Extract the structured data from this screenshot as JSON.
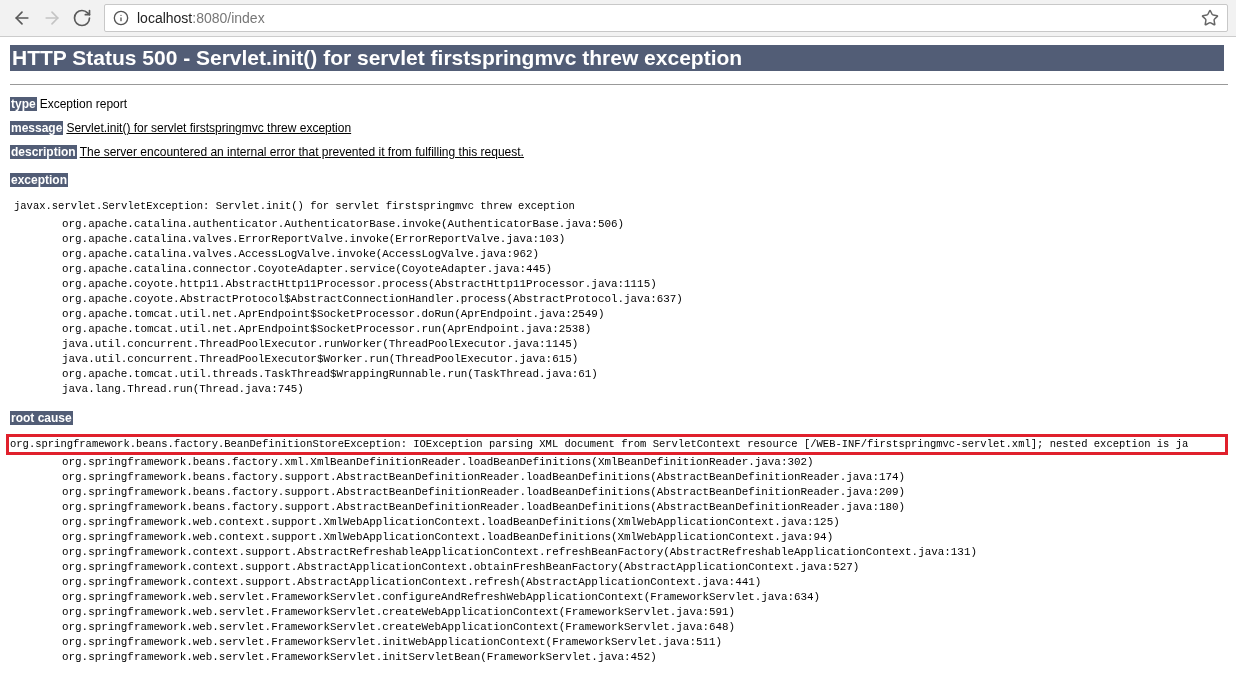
{
  "browser": {
    "nav": [
      {
        "kind": "back",
        "disabled": false
      },
      {
        "kind": "forward",
        "disabled": true
      },
      {
        "kind": "reload",
        "disabled": false
      }
    ],
    "url": {
      "host": "localhost",
      "path": ":8080/index"
    }
  },
  "page": {
    "title": "HTTP Status 500 - Servlet.init() for servlet firstspringmvc threw exception",
    "fields": [
      {
        "label": "type",
        "value": "Exception report",
        "kind": "plain"
      },
      {
        "label": "message",
        "value": "Servlet.init() for servlet firstspringmvc threw exception",
        "kind": "underlined"
      },
      {
        "label": "description",
        "value": "The server encountered an internal error that prevented it from fulfilling this request.",
        "kind": "underlined"
      }
    ],
    "traces": [
      {
        "label": "exception",
        "highlighted": false,
        "head": "javax.servlet.ServletException: Servlet.init() for servlet firstspringmvc threw exception",
        "frames": [
          "org.apache.catalina.authenticator.AuthenticatorBase.invoke(AuthenticatorBase.java:506)",
          "org.apache.catalina.valves.ErrorReportValve.invoke(ErrorReportValve.java:103)",
          "org.apache.catalina.valves.AccessLogValve.invoke(AccessLogValve.java:962)",
          "org.apache.catalina.connector.CoyoteAdapter.service(CoyoteAdapter.java:445)",
          "org.apache.coyote.http11.AbstractHttp11Processor.process(AbstractHttp11Processor.java:1115)",
          "org.apache.coyote.AbstractProtocol$AbstractConnectionHandler.process(AbstractProtocol.java:637)",
          "org.apache.tomcat.util.net.AprEndpoint$SocketProcessor.doRun(AprEndpoint.java:2549)",
          "org.apache.tomcat.util.net.AprEndpoint$SocketProcessor.run(AprEndpoint.java:2538)",
          "java.util.concurrent.ThreadPoolExecutor.runWorker(ThreadPoolExecutor.java:1145)",
          "java.util.concurrent.ThreadPoolExecutor$Worker.run(ThreadPoolExecutor.java:615)",
          "org.apache.tomcat.util.threads.TaskThread$WrappingRunnable.run(TaskThread.java:61)",
          "java.lang.Thread.run(Thread.java:745)"
        ]
      },
      {
        "label": "root cause",
        "highlighted": true,
        "head": "org.springframework.beans.factory.BeanDefinitionStoreException: IOException parsing XML document from ServletContext resource [/WEB-INF/firstspringmvc-servlet.xml]; nested exception is ja",
        "frames": [
          "org.springframework.beans.factory.xml.XmlBeanDefinitionReader.loadBeanDefinitions(XmlBeanDefinitionReader.java:302)",
          "org.springframework.beans.factory.support.AbstractBeanDefinitionReader.loadBeanDefinitions(AbstractBeanDefinitionReader.java:174)",
          "org.springframework.beans.factory.support.AbstractBeanDefinitionReader.loadBeanDefinitions(AbstractBeanDefinitionReader.java:209)",
          "org.springframework.beans.factory.support.AbstractBeanDefinitionReader.loadBeanDefinitions(AbstractBeanDefinitionReader.java:180)",
          "org.springframework.web.context.support.XmlWebApplicationContext.loadBeanDefinitions(XmlWebApplicationContext.java:125)",
          "org.springframework.web.context.support.XmlWebApplicationContext.loadBeanDefinitions(XmlWebApplicationContext.java:94)",
          "org.springframework.context.support.AbstractRefreshableApplicationContext.refreshBeanFactory(AbstractRefreshableApplicationContext.java:131)",
          "org.springframework.context.support.AbstractApplicationContext.obtainFreshBeanFactory(AbstractApplicationContext.java:527)",
          "org.springframework.context.support.AbstractApplicationContext.refresh(AbstractApplicationContext.java:441)",
          "org.springframework.web.servlet.FrameworkServlet.configureAndRefreshWebApplicationContext(FrameworkServlet.java:634)",
          "org.springframework.web.servlet.FrameworkServlet.createWebApplicationContext(FrameworkServlet.java:591)",
          "org.springframework.web.servlet.FrameworkServlet.createWebApplicationContext(FrameworkServlet.java:648)",
          "org.springframework.web.servlet.FrameworkServlet.initWebApplicationContext(FrameworkServlet.java:511)",
          "org.springframework.web.servlet.FrameworkServlet.initServletBean(FrameworkServlet.java:452)"
        ]
      }
    ]
  }
}
